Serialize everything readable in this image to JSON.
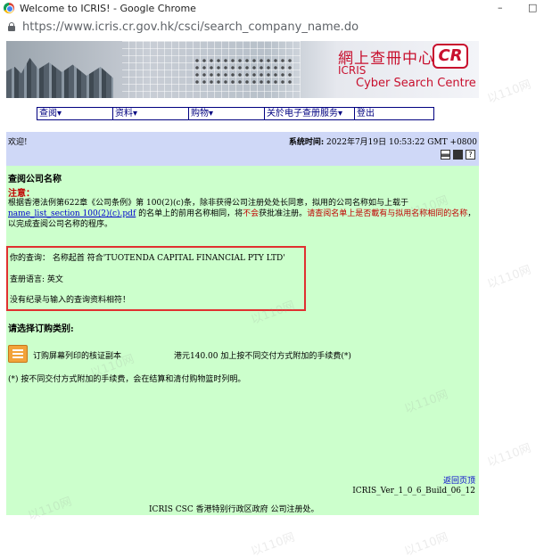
{
  "window": {
    "title": "Welcome to ICRIS! - Google Chrome",
    "minimize": "–",
    "maximize": "□"
  },
  "address": {
    "url": "https://www.icris.cr.gov.hk/csci/search_company_name.do"
  },
  "banner": {
    "title_cn": "網上查冊中心",
    "logo": "CR",
    "icris": "ICRIS",
    "title_en": "Cyber Search Centre"
  },
  "menu": [
    {
      "label": "查阅▾"
    },
    {
      "label": "资料▾"
    },
    {
      "label": "购物▾"
    },
    {
      "label": "关於电子查册服务▾"
    },
    {
      "label": "登出"
    }
  ],
  "header": {
    "welcome": "欢迎!",
    "systime_label": "系统时间:",
    "systime_value": " 2022年7月19日 10:53:22 GMT +0800"
  },
  "icons": [
    "printer-icon",
    "save-icon",
    "help-icon"
  ],
  "main": {
    "section_title": "查阅公司名称",
    "notice_head": "注意：",
    "notice_1": "根据香港法例第622章《公司条例》第 100(2)(c)条，除非获得公司注册处处长同意，拟用的公司名称如与上载于",
    "notice_link": "name_list_section 100(2)(c).pdf",
    "notice_2": " 的名单上的前用名称相同，将",
    "notice_red_1": "不会",
    "notice_3": "获批准注册。",
    "notice_red_2": "请查阅名单上是否載有与拟用名称相同的名称",
    "notice_4": "，以完成查阅公司名称的程序。"
  },
  "result": {
    "query": "你的查询： 名称起首 符合'TUOTENDA CAPITAL FINANCIAL PTY LTD'",
    "language": "查册语言: 英文",
    "message": "没有纪录与输入的查询资料相符！"
  },
  "order": {
    "title": "请选择订购类别:",
    "item_label": "订购屏幕列印的核证副本",
    "item_price": "港元140.00 加上按不同交付方式附加的手续费(*)",
    "footnote": "(*) 按不同交付方式附加的手续费，会在结算和清付购物篮时列明。"
  },
  "footer": {
    "back": "返回页顶",
    "version": "ICRIS_Ver_1_0_6_Build_06_12",
    "owner": "ICRIS CSC 香港特别行政区政府 公司注册处。"
  },
  "watermark": "以110网"
}
